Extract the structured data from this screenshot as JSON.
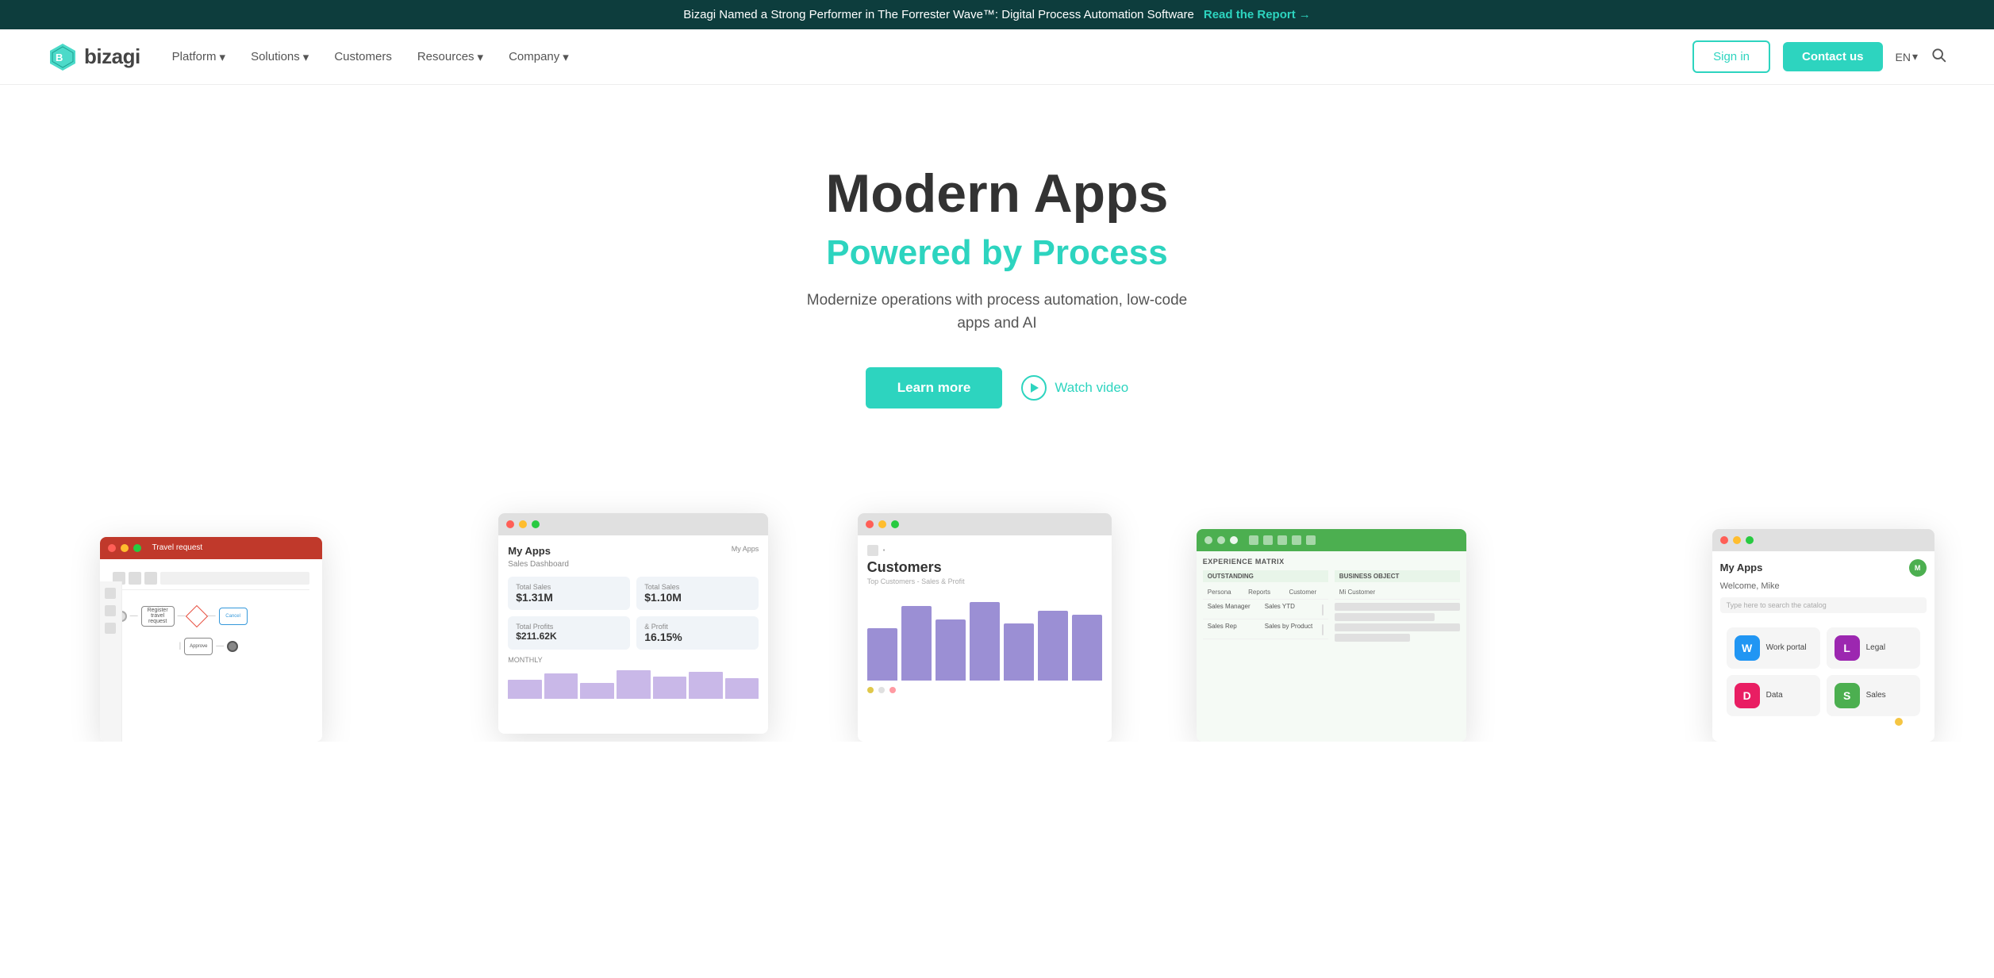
{
  "banner": {
    "text": "Bizagi Named a Strong Performer in The Forrester Wave™: Digital Process Automation Software",
    "cta_label": "Read the Report",
    "cta_arrow": "→"
  },
  "header": {
    "logo_name": "bizagi",
    "nav_items": [
      {
        "label": "Platform",
        "has_dropdown": true
      },
      {
        "label": "Solutions",
        "has_dropdown": true
      },
      {
        "label": "Customers",
        "has_dropdown": false
      },
      {
        "label": "Resources",
        "has_dropdown": true
      },
      {
        "label": "Company",
        "has_dropdown": true
      }
    ],
    "sign_in_label": "Sign in",
    "contact_label": "Contact us",
    "lang": "EN"
  },
  "hero": {
    "title": "Modern Apps",
    "subtitle": "Powered by Process",
    "description": "Modernize operations with process automation, low-code apps and AI",
    "learn_more_label": "Learn more",
    "watch_video_label": "Watch video"
  },
  "screenshots": {
    "process_title": "Travel request",
    "myapps_title": "My Apps",
    "myapps_subtitle": "Sales Dashboard",
    "stats": [
      {
        "label": "Total Sales",
        "value": "$1.31M"
      },
      {
        "label": "Total Sales",
        "value": "$1.10M"
      },
      {
        "label": "Total Profits",
        "value": "$211.62K"
      },
      {
        "label": "& Profit",
        "value": "16.15%"
      }
    ],
    "customers_title": "Customers",
    "customers_subtitle": "Top Customers - Sales & Profit",
    "bars": [
      60,
      85,
      70,
      90,
      65,
      80,
      75
    ],
    "experience_title": "EXPERIENCE MATRIX",
    "experience_items": [
      {
        "row": "Persona",
        "col": "Reports",
        "col2": "Customer"
      },
      {
        "row": "Sales Manager",
        "col": "Sales YTD",
        "col2": ""
      },
      {
        "row": "Sales Rep",
        "col": "Sales by Product",
        "col2": ""
      }
    ],
    "myapps_right_title": "My Apps",
    "myapps_right_welcome": "Welcome, Mike",
    "apps": [
      {
        "name": "Work portal",
        "color": "#2196f3",
        "icon": "W"
      },
      {
        "name": "Legal",
        "color": "#9c27b0",
        "icon": "L"
      },
      {
        "name": "Data",
        "color": "#e91e63",
        "icon": "D"
      },
      {
        "name": "Sales",
        "color": "#4caf50",
        "icon": "S"
      }
    ]
  }
}
